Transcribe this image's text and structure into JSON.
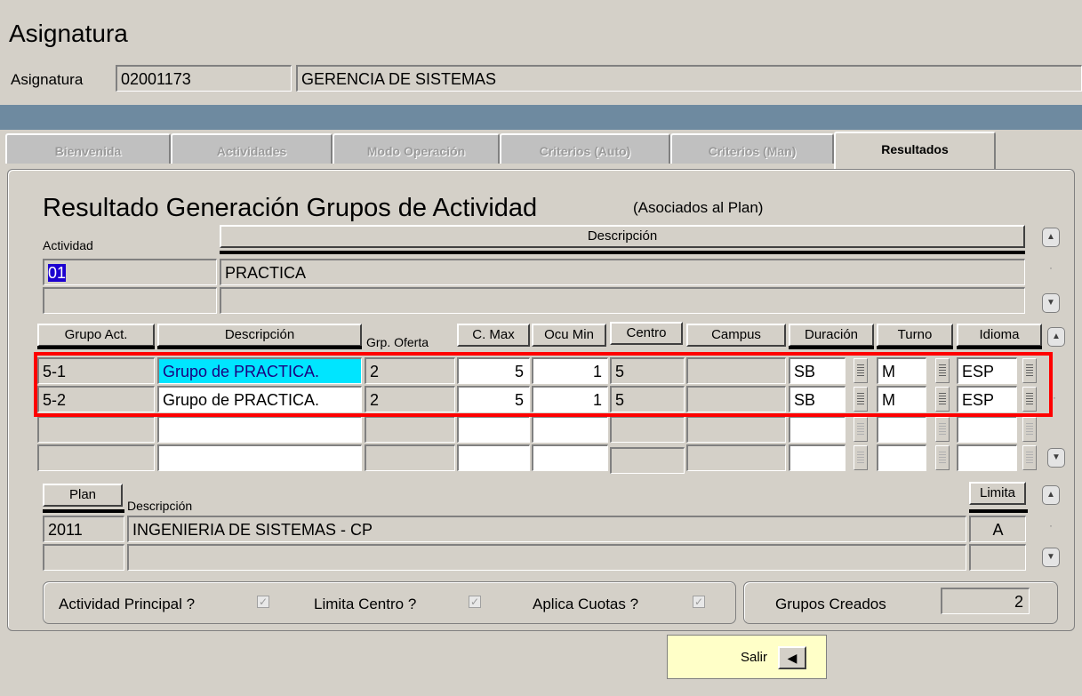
{
  "window": {
    "title": "Asignatura"
  },
  "header": {
    "asignatura_label": "Asignatura",
    "code": "02001173",
    "name": "GERENCIA DE SISTEMAS"
  },
  "tabs": [
    {
      "label": "Bienvenida",
      "active": false
    },
    {
      "label": "Actividades",
      "active": false
    },
    {
      "label": "Modo Operación",
      "active": false
    },
    {
      "label": "Criterios (Auto)",
      "active": false
    },
    {
      "label": "Criterios (Man)",
      "active": false
    },
    {
      "label": "Resultados",
      "active": true
    }
  ],
  "panel": {
    "title": "Resultado Generación Grupos de Actividad",
    "subtitle": "(Asociados al Plan)"
  },
  "actividad": {
    "col_actividad": "Actividad",
    "col_descripcion": "Descripción",
    "rows": [
      {
        "code": "01",
        "desc": "PRACTICA"
      },
      {
        "code": "",
        "desc": ""
      }
    ]
  },
  "grupos": {
    "columns": [
      "Grupo Act.",
      "Descripción",
      "Grp. Oferta",
      "C. Max",
      "Ocu Min",
      "Centro",
      "Campus",
      "Duración",
      "Turno",
      "Idioma"
    ],
    "rows": [
      {
        "grupo": "5-1",
        "desc": "Grupo de PRACTICA.",
        "oferta": "2",
        "cmax": "5",
        "ocumin": "1",
        "centro": "5",
        "campus": "",
        "duracion": "SB",
        "turno": "M",
        "idioma": "ESP"
      },
      {
        "grupo": "5-2",
        "desc": "Grupo de PRACTICA.",
        "oferta": "2",
        "cmax": "5",
        "ocumin": "1",
        "centro": "5",
        "campus": "",
        "duracion": "SB",
        "turno": "M",
        "idioma": "ESP"
      }
    ]
  },
  "plan": {
    "col_plan": "Plan",
    "col_descripcion": "Descripción",
    "col_limita": "Limita",
    "rows": [
      {
        "plan": "2011",
        "desc": "INGENIERIA DE SISTEMAS - CP",
        "limita": "A"
      },
      {
        "plan": "",
        "desc": "",
        "limita": ""
      }
    ]
  },
  "flags": {
    "actividad_principal": "Actividad Principal ?",
    "limita_centro": "Limita Centro ?",
    "aplica_cuotas": "Aplica Cuotas ?",
    "check_glyph": "✓"
  },
  "grupos_creados": {
    "label": "Grupos Creados",
    "value": "2"
  },
  "salir": {
    "label": "Salir",
    "icon": "◀"
  },
  "icons": {
    "scroll_up": "▲",
    "scroll_down": "▼",
    "scroll_mid": "·"
  },
  "colors": {
    "highlight": "#00e5ff",
    "selection": "#1c00d0",
    "annotation": "#ff0000",
    "exit_panel": "#ffffc8"
  }
}
